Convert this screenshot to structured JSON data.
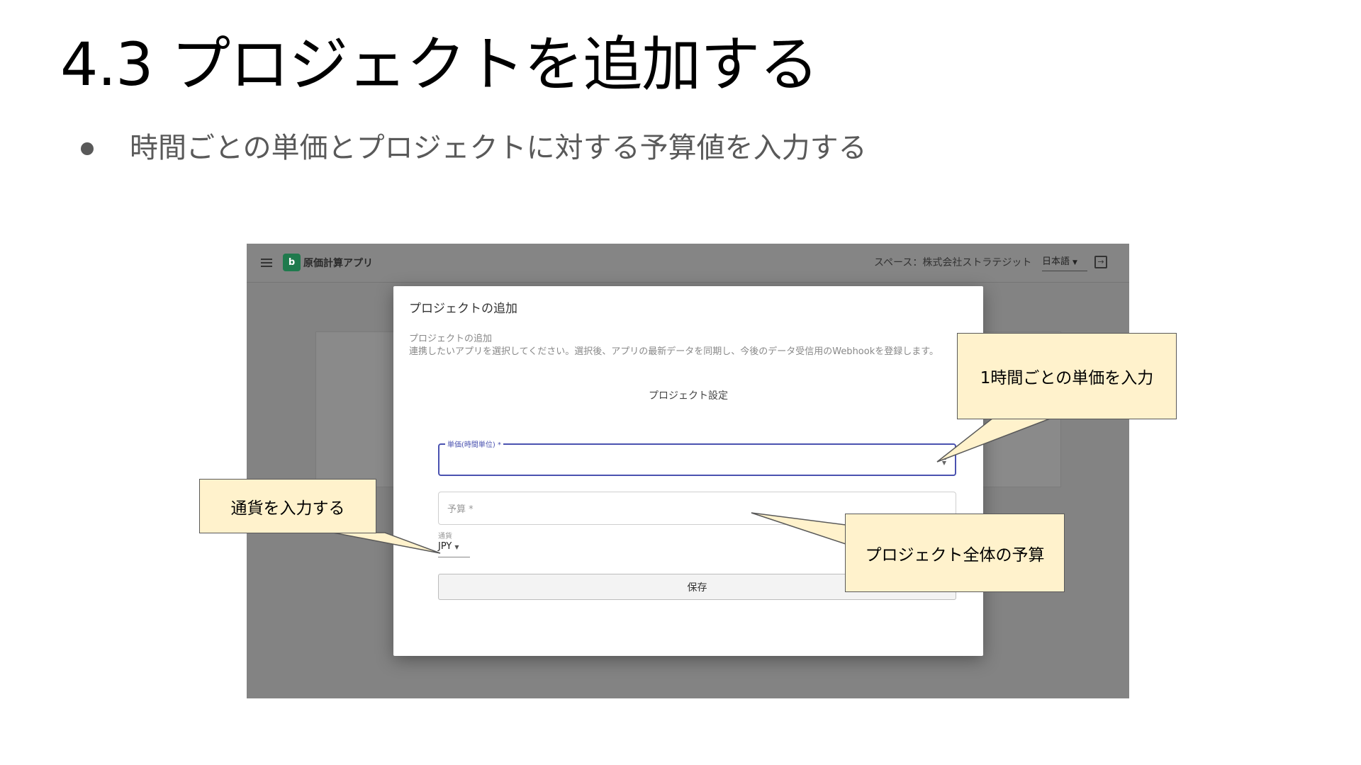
{
  "slide": {
    "title": "4.3 プロジェクトを追加する",
    "bullet": "時間ごとの単価とプロジェクトに対する予算値を入力する"
  },
  "app": {
    "logo_letter": "b",
    "name": "原価計算アプリ",
    "space_label": "スペース：株式会社ストラテジット",
    "language": "日本語"
  },
  "modal": {
    "title": "プロジェクトの追加",
    "description_title": "プロジェクトの追加",
    "description": "連携したいアプリを選択してください。選択後、アプリの最新データを同期し、今後のデータ受信用のWebhookを登録します。",
    "section_title": "プロジェクト設定",
    "unit_price_label": "単価(時間単位) *",
    "budget_label": "予算 *",
    "currency_label": "通貨",
    "currency_value": "JPY",
    "save_label": "保存"
  },
  "callouts": {
    "unit_price": "1時間ごとの単価を入力",
    "currency": "通貨を入力する",
    "budget": "プロジェクト全体の予算"
  },
  "colors": {
    "callout_fill": "#fff2cc",
    "focus_border": "#4a52b0",
    "logo_green": "#1f7a4d",
    "overlay_gray": "#838383"
  }
}
